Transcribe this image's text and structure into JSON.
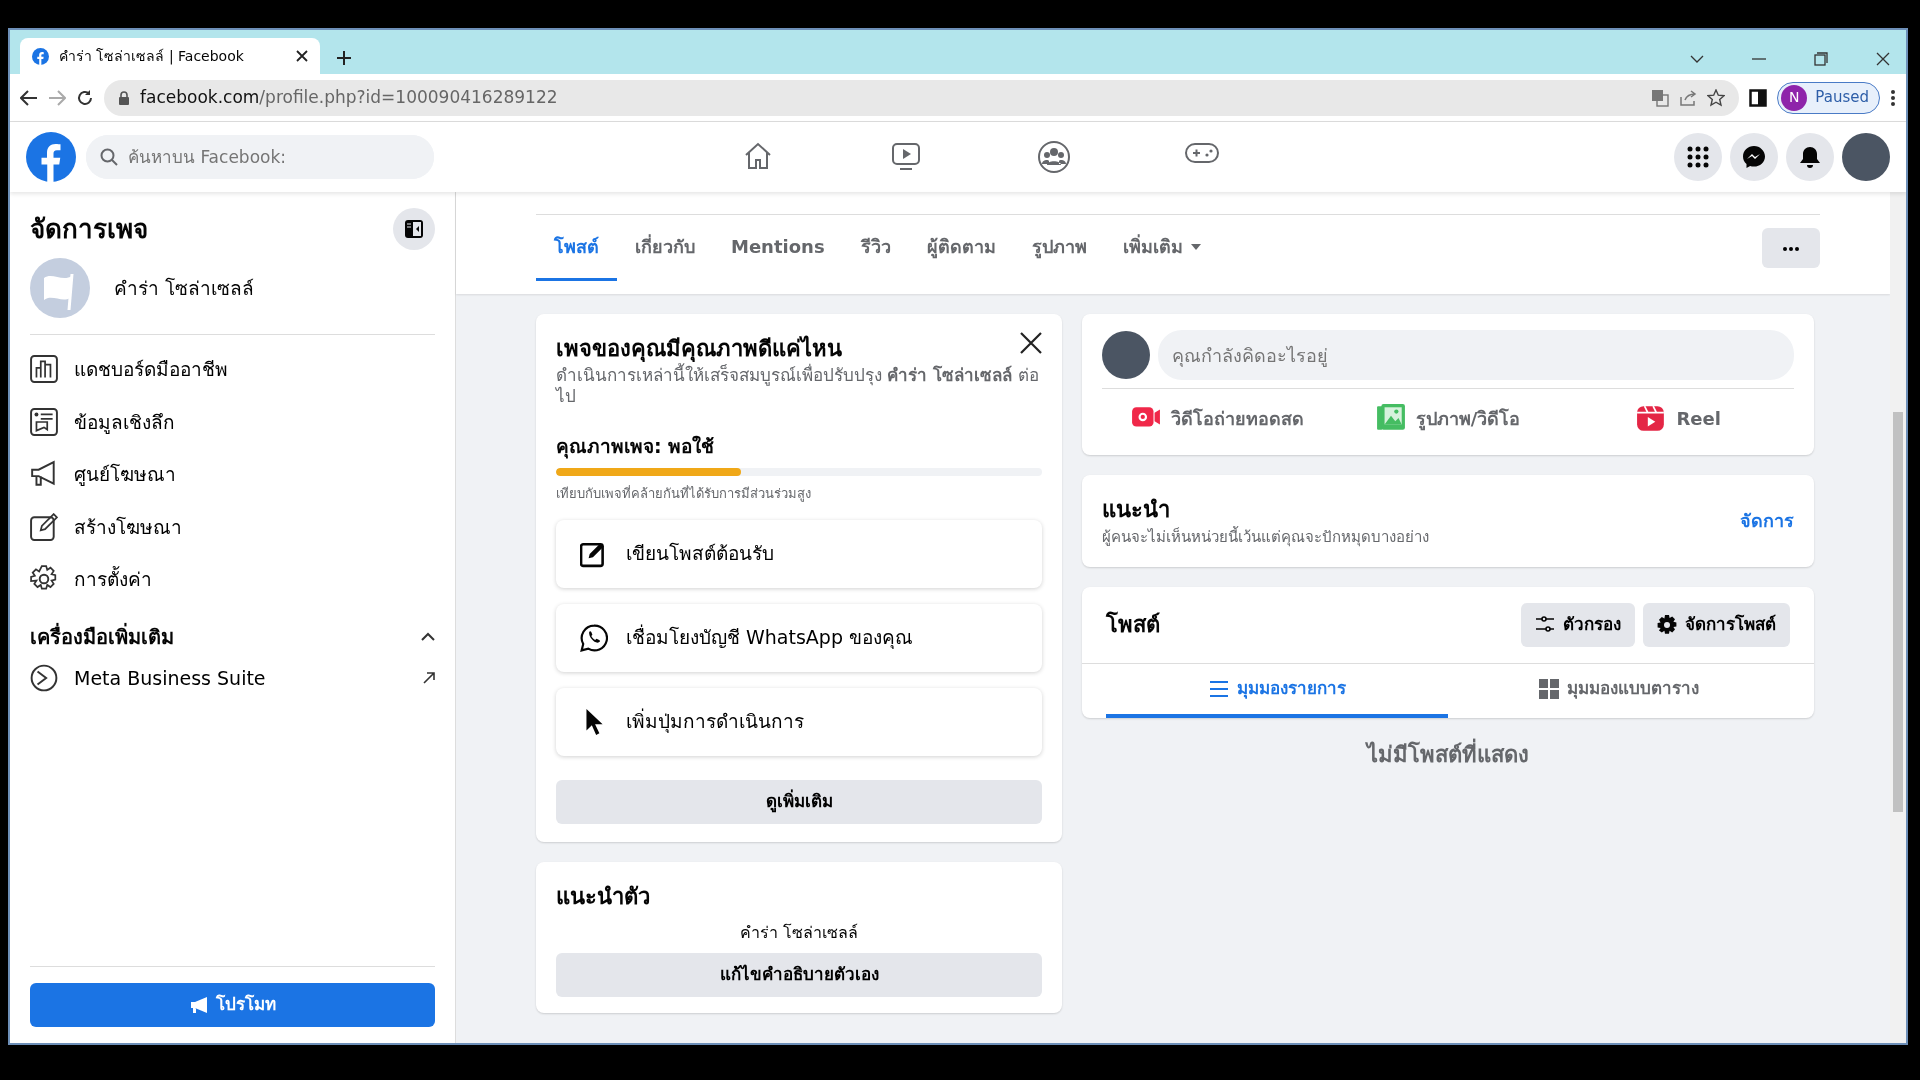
{
  "browser": {
    "tab_title": "คำร่า โซล่าเซลล์ | Facebook",
    "url_domain": "facebook.com",
    "url_path": "/profile.php?id=100090416289122",
    "profile_initial": "N",
    "profile_status": "Paused"
  },
  "header": {
    "search_placeholder": "ค้นหาบน Facebook:"
  },
  "sidebar": {
    "title": "จัดการเพจ",
    "page_name": "คำร่า โซล่าเซลล์",
    "items": [
      {
        "kind": "dashboard",
        "label": "แดชบอร์ดมืออาชีพ"
      },
      {
        "kind": "insights",
        "label": "ข้อมูลเชิงลึก"
      },
      {
        "kind": "ads",
        "label": "ศูนย์โฆษณา"
      },
      {
        "kind": "create",
        "label": "สร้างโฆษณา"
      },
      {
        "kind": "settings",
        "label": "การตั้งค่า"
      }
    ],
    "section": {
      "title": "เครื่องมือเพิ่มเติม",
      "expanded": true,
      "tools": [
        "Meta Business Suite"
      ]
    },
    "promote_button": "โปรโมท"
  },
  "profile_tabs": [
    {
      "label": "โพสต์",
      "selected": true
    },
    {
      "label": "เกี่ยวกับ",
      "selected": false
    },
    {
      "label": "Mentions",
      "selected": false
    },
    {
      "label": "รีวิว",
      "selected": false
    },
    {
      "label": "ผู้ติดตาม",
      "selected": false
    },
    {
      "label": "รูปภาพ",
      "selected": false
    },
    {
      "label": "เพิ่มเติม",
      "selected": false,
      "kind": "dropdown"
    }
  ],
  "quality_card": {
    "title": "เพจของคุณมีคุณภาพดีแค่ไหน",
    "description": "ดำเนินการเหล่านี้ให้เสร็จสมบูรณ์เพื่อปรับปรุง **คำร่า โซล่าเซลล์** ต่อไป",
    "quality": "คุณภาพเพจ: พอใช้",
    "level": 0.38,
    "note": "เทียบกับเพจที่คล้ายกันที่ได้รับการมีส่วนร่วมสูง",
    "actions": [
      {
        "kind": "write",
        "label": "เขียนโพสต์ต้อนรับ"
      },
      {
        "kind": "whatsapp",
        "label": "เชื่อมโยงบัญชี WhatsApp ของคุณ"
      },
      {
        "kind": "button",
        "label": "เพิ่มปุ่มการดำเนินการ"
      }
    ],
    "see_more": "ดูเพิ่มเติม"
  },
  "intro_card": {
    "title": "แนะนำตัว",
    "bio": "คำร่า โซล่าเซลล์",
    "button": "แก้ไขคำอธิบายตัวเอง"
  },
  "composer": {
    "placeholder": "คุณกำลังคิดอะไรอยู่",
    "actions": [
      {
        "kind": "live",
        "label": "วิดีโอถ่ายทอดสด"
      },
      {
        "kind": "photo",
        "label": "รูปภาพ/วิดีโอ"
      },
      {
        "kind": "reel",
        "label": "Reel"
      }
    ]
  },
  "featured": {
    "title": "แนะนำ",
    "subtitle": "ผู้คนจะไม่เห็นหน่วยนี้เว้นแต่คุณจะปักหมุดบางอย่าง",
    "link": "จัดการ"
  },
  "posts": {
    "title": "โพสต์",
    "buttons": [
      {
        "kind": "filter",
        "label": "ตัวกรอง"
      },
      {
        "kind": "manage",
        "label": "จัดการโพสต์"
      }
    ],
    "views": [
      {
        "kind": "list",
        "label": "มุมมองรายการ",
        "selected": true
      },
      {
        "kind": "grid",
        "label": "มุมมองแบบตาราง",
        "selected": false
      }
    ],
    "empty": "ไม่มีโพสต์ที่แสดง"
  }
}
